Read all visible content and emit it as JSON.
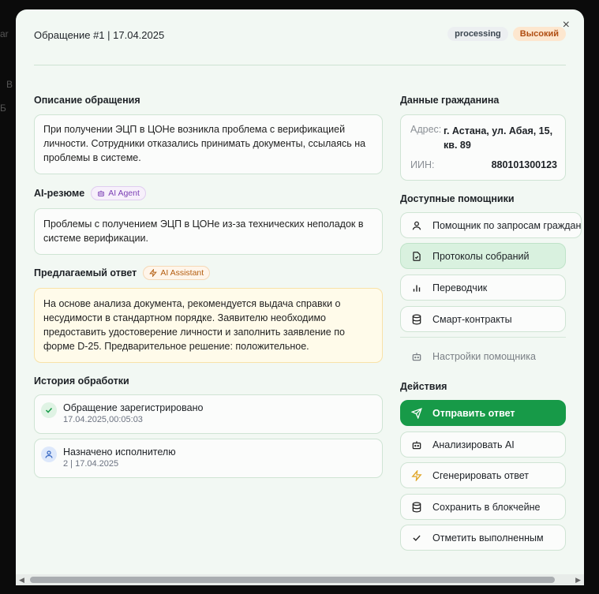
{
  "header": {
    "title": "Обращение #1 | 17.04.2025",
    "status": "processing",
    "priority": "Высокий",
    "close_glyph": "×"
  },
  "description": {
    "title": "Описание обращения",
    "text": "При получении ЭЦП в ЦОНе возникла проблема с верификацией личности. Сотрудники отказались принимать документы, ссылаясь на проблемы в системе."
  },
  "ai_summary": {
    "title": "AI-резюме",
    "badge": "AI Agent",
    "text": "Проблемы с получением ЭЦП в ЦОНе из-за технических неполадок в системе верификации."
  },
  "proposed": {
    "title": "Предлагаемый ответ",
    "badge": "AI Assistant",
    "text": "На основе анализа документа, рекомендуется выдача справки о несудимости в стандартном порядке. Заявителю необходимо предоставить удостоверение личности и заполнить заявление по форме D-25. Предварительное решение: положительное."
  },
  "history": {
    "title": "История обработки",
    "items": [
      {
        "title": "Обращение зарегистрировано",
        "date": "17.04.2025,00:05:03",
        "icon": "check-icon"
      },
      {
        "title": "Назначено исполнителю",
        "date": "2 | 17.04.2025",
        "icon": "user-icon"
      }
    ]
  },
  "citizen": {
    "title": "Данные гражданина",
    "address_label": "Адрес:",
    "address_value": "г. Астана, ул. Абая, 15, кв. 89",
    "iin_label": "ИИН:",
    "iin_value": "880101300123"
  },
  "assistants": {
    "title": "Доступные помощники",
    "items": [
      {
        "label": "Помощник по запросам граждан",
        "icon": "user-icon"
      },
      {
        "label": "Протоколы собраний",
        "icon": "file-check-icon",
        "active": true
      },
      {
        "label": "Переводчик",
        "icon": "bar-chart-icon"
      },
      {
        "label": "Смарт-контракты",
        "icon": "database-icon"
      }
    ],
    "settings_label": "Настройки помощника"
  },
  "actions": {
    "title": "Действия",
    "items": [
      {
        "label": "Отправить ответ",
        "icon": "send-icon"
      },
      {
        "label": "Анализировать AI",
        "icon": "bot-icon"
      },
      {
        "label": "Сгенерировать ответ",
        "icon": "zap-icon"
      },
      {
        "label": "Сохранить в блокчейне",
        "icon": "database-icon"
      },
      {
        "label": "Отметить выполненным",
        "icon": "check-icon"
      }
    ]
  },
  "colors": {
    "accent_green": "#179a48",
    "modal_bg": "#f2f8f3",
    "priority_bg": "#fde7cf",
    "priority_text": "#b04e12"
  }
}
